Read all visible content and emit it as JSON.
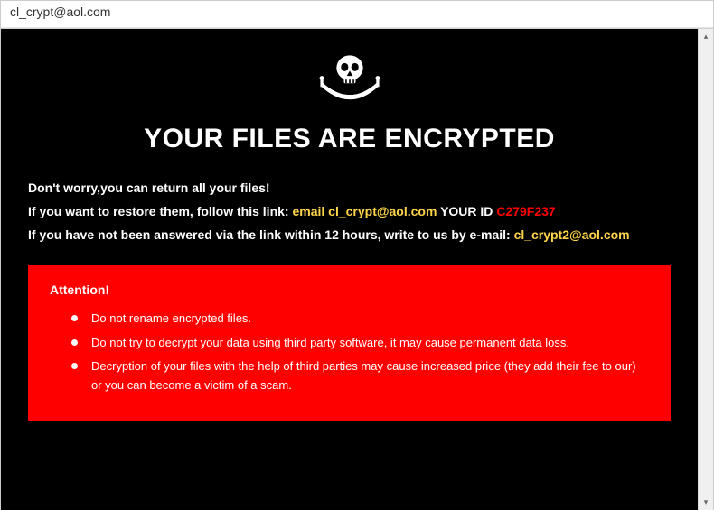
{
  "window": {
    "title": "cl_crypt@aol.com"
  },
  "skull_icon_name": "skull-crossed-swords-icon",
  "headline": "YOUR FILES ARE ENCRYPTED",
  "instructions": {
    "line1": "Don't worry,you can return all your files!",
    "line2_a": "If you want to restore them, follow this link: ",
    "line2_email_prefix": "email ",
    "line2_email": "cl_crypt@aol.com",
    "line2_uid_label": "  YOUR ID ",
    "line2_uid": "C279F237",
    "line3_a": "If you have not been answered via the link within 12 hours, write to us by e-mail: ",
    "line3_email": "cl_crypt2@aol.com"
  },
  "attention": {
    "title": "Attention!",
    "items": [
      "Do not rename encrypted files.",
      "Do not try to decrypt your data using third party software, it may cause permanent data loss.",
      "Decryption of your files with the help of third parties may cause increased price (they add their fee to our) or you can become a victim of a scam."
    ]
  },
  "scrollbar": {
    "up": "▴",
    "down": "▾"
  }
}
